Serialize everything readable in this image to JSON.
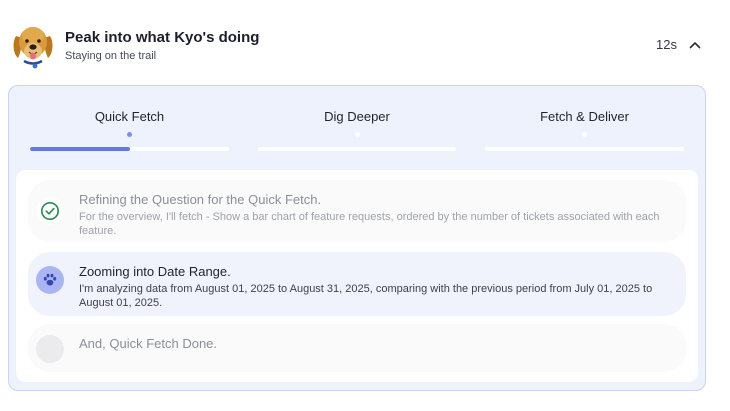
{
  "header": {
    "title": "Peak into what Kyo's doing",
    "subtitle": "Staying on the trail",
    "elapsed": "12s",
    "avatar_icon": "dog-avatar",
    "collapse_icon": "chevron-up-icon"
  },
  "tabs": [
    {
      "label": "Quick Fetch",
      "progress": 0.5,
      "active": true
    },
    {
      "label": "Dig Deeper",
      "progress": 0,
      "active": false
    },
    {
      "label": "Fetch & Deliver",
      "progress": 0,
      "active": false
    }
  ],
  "steps": [
    {
      "title": "Refining the Question for the Quick Fetch.",
      "description": "For the overview, I'll fetch - Show a bar chart of feature requests, ordered by the number of tickets associated with each feature.",
      "status": "done",
      "icon": "check-circle-icon"
    },
    {
      "title": "Zooming into Date Range.",
      "description": "I'm analyzing data from August 01, 2025 to August 31, 2025, comparing with the previous period from July 01, 2025 to August 01, 2025.",
      "status": "in-progress",
      "icon": "paw-icon"
    },
    {
      "title": "And, Quick Fetch Done.",
      "description": "",
      "status": "pending",
      "icon": "empty-circle-icon"
    }
  ],
  "colors": {
    "accent": "#6677e2",
    "panel_bg": "#eef2fd",
    "panel_border": "#c8d3f5",
    "check_green": "#2e8b57"
  }
}
